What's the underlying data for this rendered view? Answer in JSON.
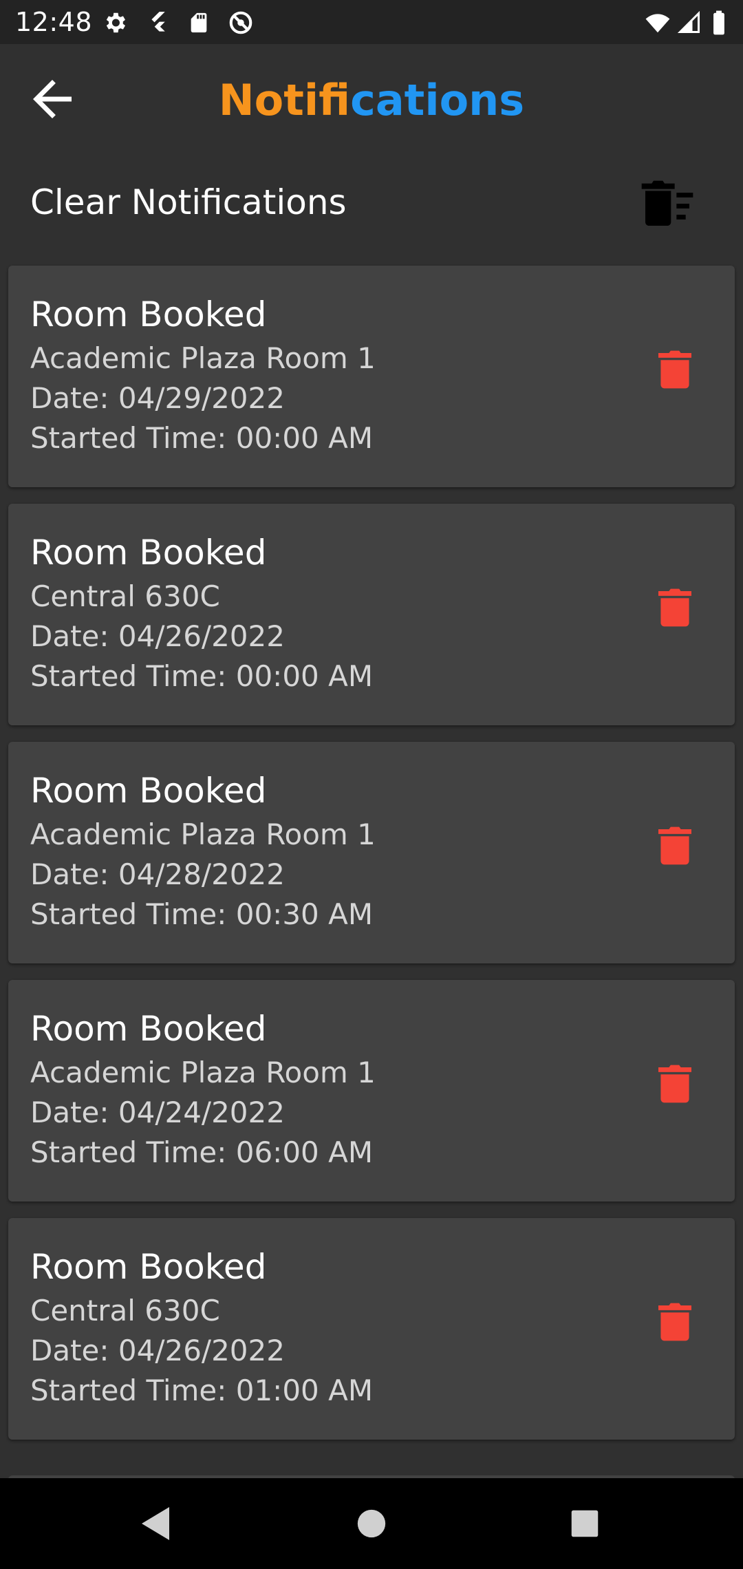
{
  "status_bar": {
    "time": "12:48",
    "icons_left": [
      "gear-icon",
      "flutter-icon",
      "sd-card-icon",
      "at-sign-icon"
    ],
    "icons_right": [
      "wifi-icon",
      "signal-icon",
      "battery-icon"
    ]
  },
  "header": {
    "back_icon": "arrow-left-icon",
    "title_part1": "Notifi",
    "title_part2": "cations",
    "title_color1": "#f7941d",
    "title_color2": "#2196f3"
  },
  "clear": {
    "label": "Clear Notifications",
    "icon": "delete-sweep-icon"
  },
  "notifications": [
    {
      "title": "Room Booked",
      "room": "Academic Plaza Room 1",
      "date": "Date: 04/29/2022",
      "time": "Started Time: 00:00 AM"
    },
    {
      "title": "Room Booked",
      "room": "Central 630C",
      "date": "Date: 04/26/2022",
      "time": "Started Time: 00:00 AM"
    },
    {
      "title": "Room Booked",
      "room": "Academic Plaza Room 1",
      "date": "Date: 04/28/2022",
      "time": "Started Time: 00:30 AM"
    },
    {
      "title": "Room Booked",
      "room": "Academic Plaza Room 1",
      "date": "Date: 04/24/2022",
      "time": "Started Time: 06:00 AM"
    },
    {
      "title": "Room Booked",
      "room": "Central 630C",
      "date": "Date: 04/26/2022",
      "time": "Started Time: 01:00 AM"
    }
  ],
  "colors": {
    "background": "#303030",
    "card": "#424242",
    "delete_icon": "#f44336"
  },
  "nav": {
    "icons": [
      "nav-back-icon",
      "nav-home-icon",
      "nav-recents-icon"
    ]
  }
}
